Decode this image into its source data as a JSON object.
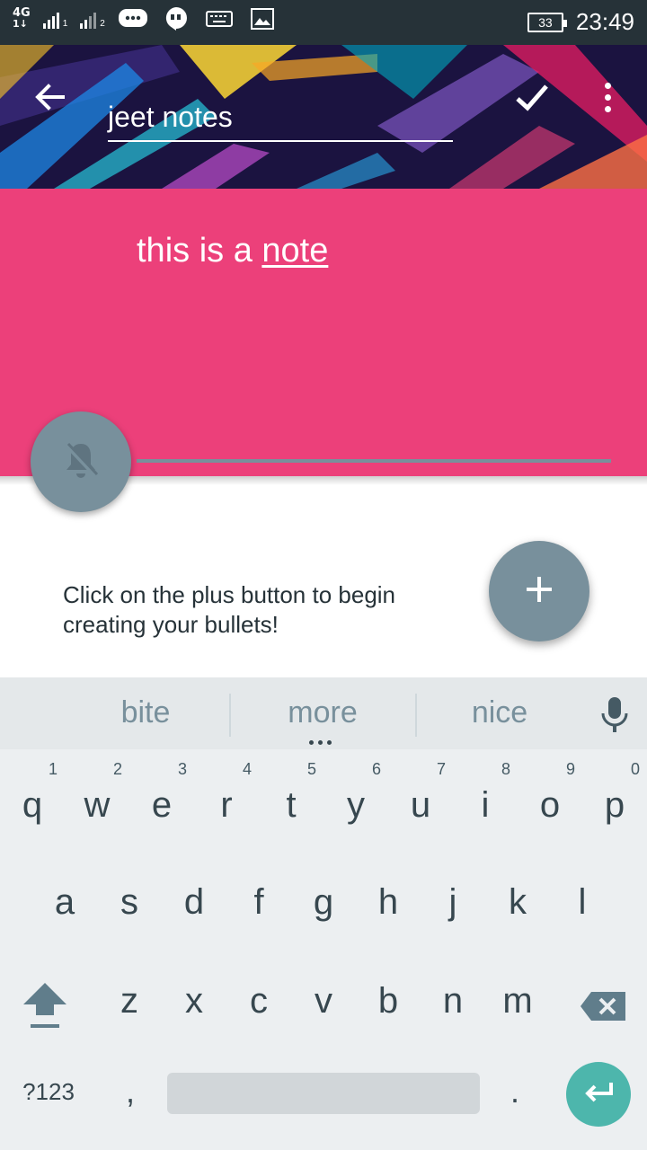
{
  "status_bar": {
    "network": "4G",
    "sim1_label": "1",
    "sim2_label": "2",
    "battery_level": "33",
    "time": "23:49"
  },
  "toolbar": {
    "title_value": "jeet notes"
  },
  "note": {
    "text_plain": "this is a ",
    "text_underlined": "note"
  },
  "empty_state": {
    "message": "Click on the plus button to begin creating your bullets!"
  },
  "keyboard": {
    "suggestions": [
      "bite",
      "more",
      "nice"
    ],
    "row1": [
      {
        "key": "q",
        "hint": "1"
      },
      {
        "key": "w",
        "hint": "2"
      },
      {
        "key": "e",
        "hint": "3"
      },
      {
        "key": "r",
        "hint": "4"
      },
      {
        "key": "t",
        "hint": "5"
      },
      {
        "key": "y",
        "hint": "6"
      },
      {
        "key": "u",
        "hint": "7"
      },
      {
        "key": "i",
        "hint": "8"
      },
      {
        "key": "o",
        "hint": "9"
      },
      {
        "key": "p",
        "hint": "0"
      }
    ],
    "row2": [
      "a",
      "s",
      "d",
      "f",
      "g",
      "h",
      "j",
      "k",
      "l"
    ],
    "row3": [
      "z",
      "x",
      "c",
      "v",
      "b",
      "n",
      "m"
    ],
    "symbols_label": "?123",
    "comma": ",",
    "period": "."
  },
  "colors": {
    "note_background": "#ec407a",
    "fab": "#78909c",
    "enter_key": "#4db6ac",
    "status_bar": "#263238"
  }
}
